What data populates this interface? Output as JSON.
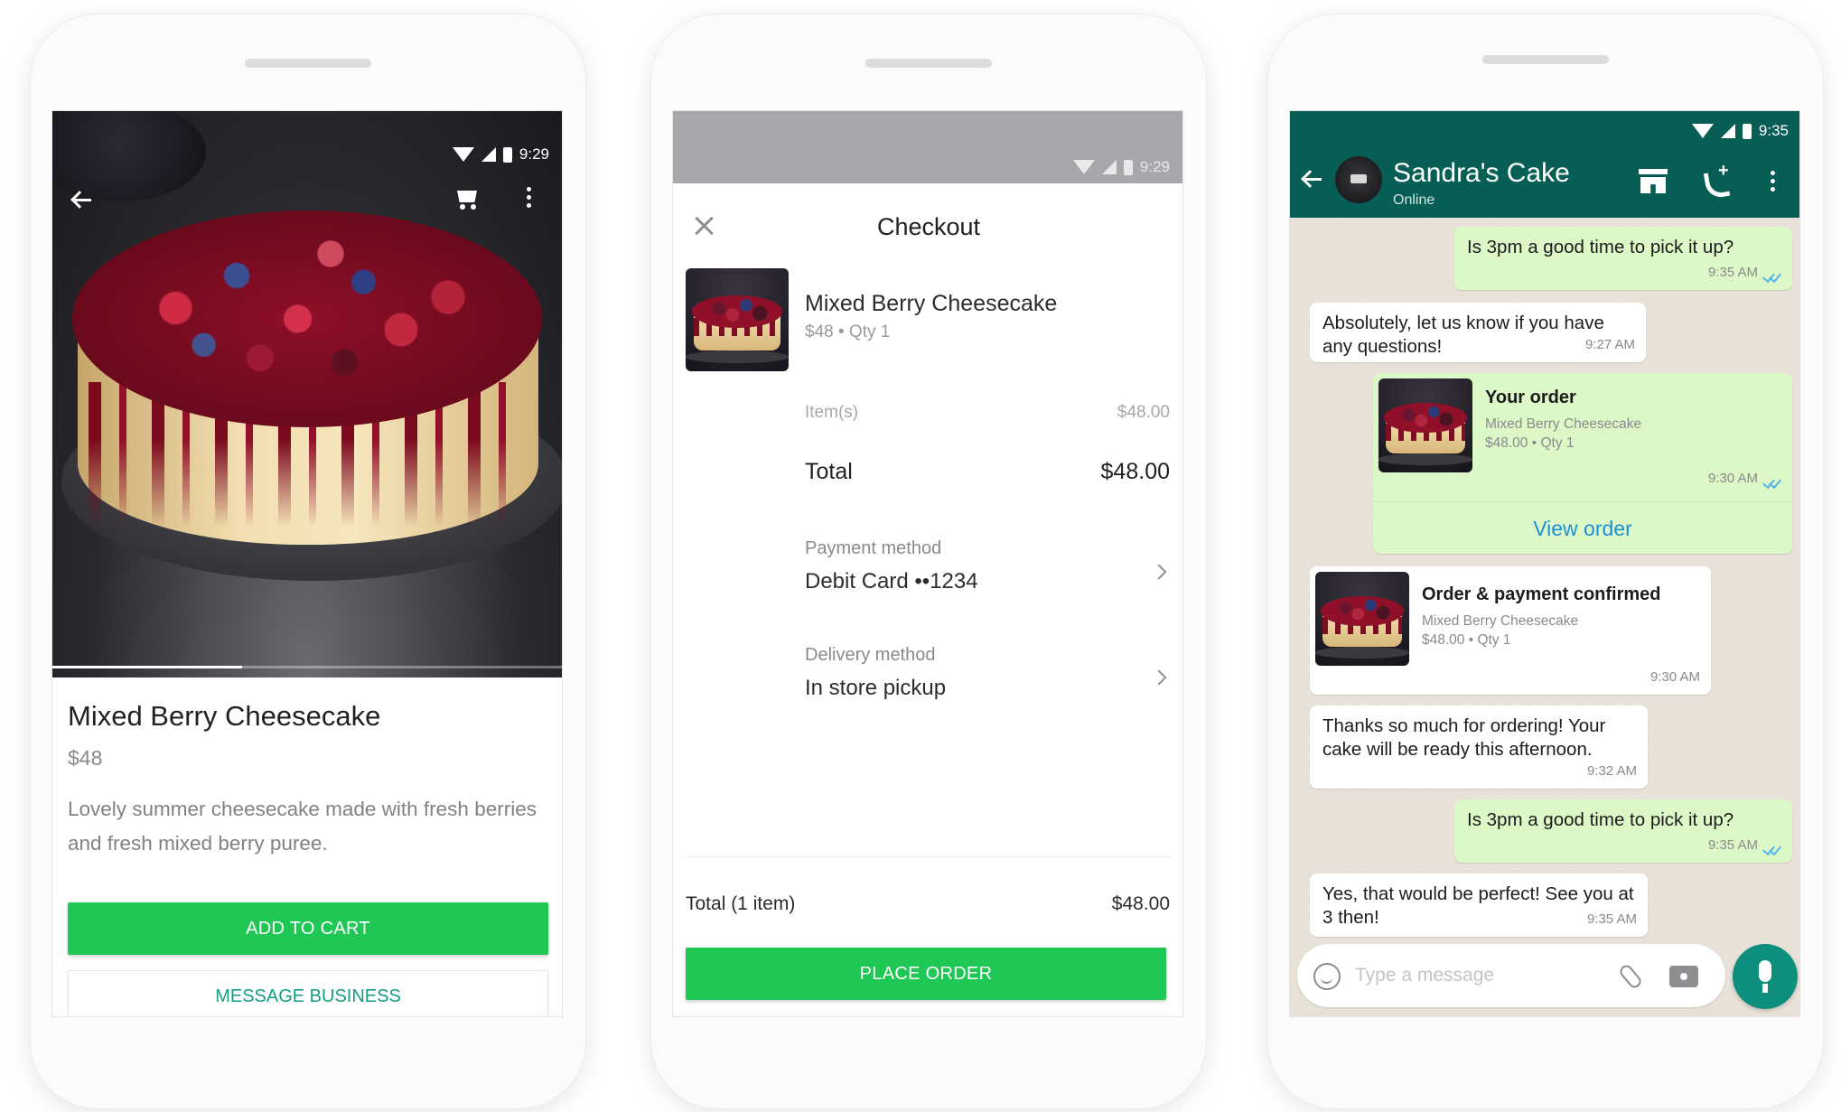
{
  "product_screen": {
    "status_time": "9:29",
    "product_name": "Mixed Berry Cheesecake",
    "price": "$48",
    "description": "Lovely summer cheesecake made with fresh berries and fresh mixed berry puree.",
    "add_to_cart_label": "ADD TO CART",
    "message_business_label": "MESSAGE BUSINESS"
  },
  "checkout_screen": {
    "status_time": "9:29",
    "title": "Checkout",
    "item_name": "Mixed Berry Cheesecake",
    "item_sub": "$48 • Qty 1",
    "items_label": "Item(s)",
    "items_value": "$48.00",
    "total_label": "Total",
    "total_value": "$48.00",
    "payment_label": "Payment method",
    "payment_value": "Debit Card ••1234",
    "delivery_label": "Delivery method",
    "delivery_value": "In store pickup",
    "footer_total_label": "Total (1 item)",
    "footer_total_value": "$48.00",
    "place_order_label": "PLACE ORDER"
  },
  "chat_screen": {
    "status_time": "9:35",
    "contact_name": "Sandra's Cake",
    "contact_status": "Online",
    "messages": [
      {
        "text": "Is 3pm a good time to pick it up?",
        "time": "9:35 AM"
      },
      {
        "text": "Absolutely, let us know if you have any questions!",
        "time": "9:27 AM"
      },
      {
        "title": "Your order",
        "sub1": "Mixed Berry Cheesecake",
        "sub2": "$48.00 • Qty 1",
        "time": "9:30 AM",
        "action": "View order"
      },
      {
        "title": "Order & payment confirmed",
        "sub1": "Mixed Berry Cheesecake",
        "sub2": "$48.00 • Qty 1",
        "time": "9:30 AM"
      },
      {
        "text": "Thanks so much for ordering! Your cake will be ready this afternoon.",
        "time": "9:32 AM"
      },
      {
        "text": "Is 3pm a good time to pick it up?",
        "time": "9:35 AM"
      },
      {
        "text": "Yes, that would be perfect! See you at 3 then!",
        "time": "9:35 AM"
      }
    ],
    "composer_placeholder": "Type a message"
  },
  "colors": {
    "green_button": "#1fc754",
    "whatsapp_teal": "#075e54",
    "outgoing_bubble": "#dcf8c6",
    "link_blue": "#1b8fd8"
  },
  "icons": [
    "back-arrow-icon",
    "cart-icon",
    "more-vert-icon",
    "close-icon",
    "chevron-right-icon",
    "shop-icon",
    "add-call-icon",
    "emoji-icon",
    "attach-icon",
    "camera-icon",
    "mic-icon",
    "wifi-icon",
    "signal-icon",
    "battery-icon",
    "read-ticks-icon"
  ]
}
